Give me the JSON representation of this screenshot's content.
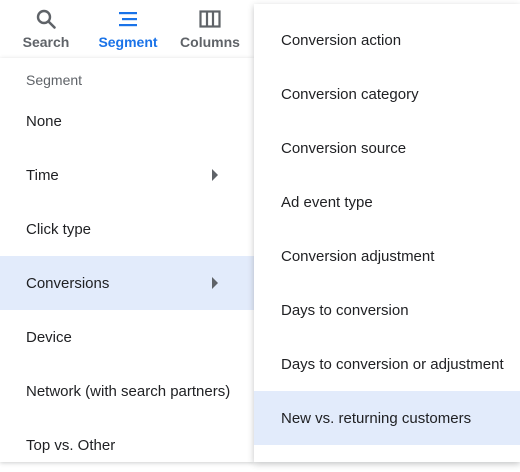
{
  "toolbar": {
    "search_label": "Search",
    "segment_label": "Segment",
    "columns_label": "Columns"
  },
  "segment_menu": {
    "header": "Segment",
    "items": [
      {
        "label": "None",
        "has_submenu": false
      },
      {
        "label": "Time",
        "has_submenu": true
      },
      {
        "label": "Click type",
        "has_submenu": false
      },
      {
        "label": "Conversions",
        "has_submenu": true,
        "selected": true
      },
      {
        "label": "Device",
        "has_submenu": false
      },
      {
        "label": "Network (with search partners)",
        "has_submenu": false
      },
      {
        "label": "Top vs. Other",
        "has_submenu": false
      }
    ]
  },
  "conversions_submenu": {
    "items": [
      {
        "label": "Conversion action"
      },
      {
        "label": "Conversion category"
      },
      {
        "label": "Conversion source"
      },
      {
        "label": "Ad event type"
      },
      {
        "label": "Conversion adjustment"
      },
      {
        "label": "Days to conversion"
      },
      {
        "label": "Days to conversion or adjustment"
      },
      {
        "label": "New vs. returning customers",
        "selected": true
      }
    ]
  },
  "colors": {
    "accent": "#1a73e8",
    "selected_bg": "#e2ebfb",
    "icon_gray": "#5f6368",
    "text": "#202124"
  }
}
